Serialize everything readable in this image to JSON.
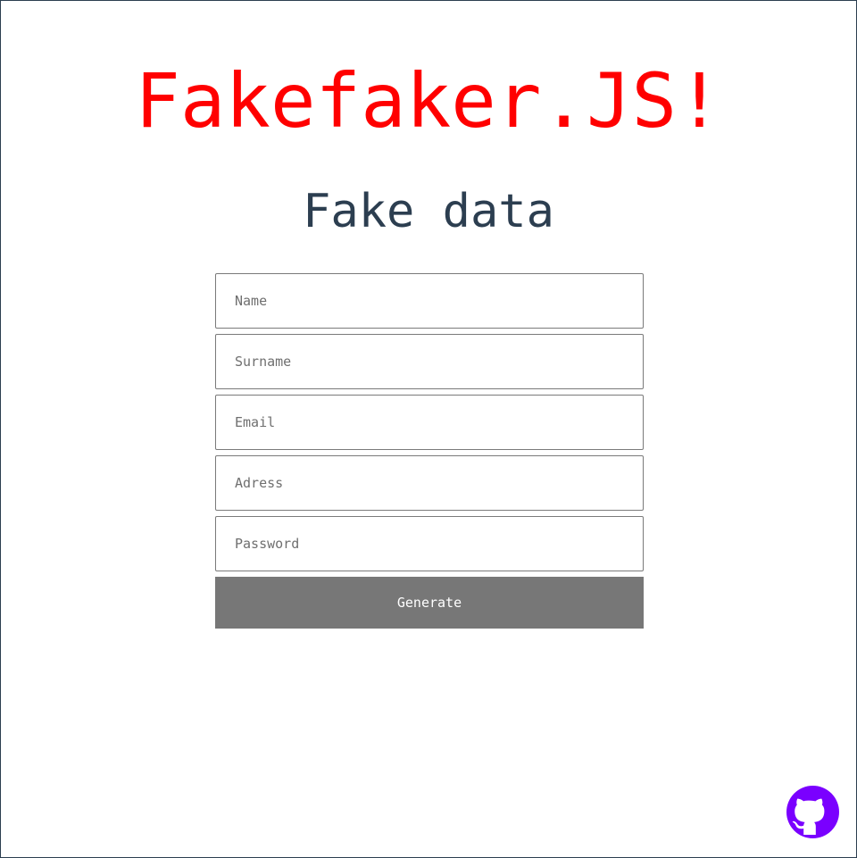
{
  "header": {
    "app_title": "Fakefaker.JS!",
    "section_title": "Fake data"
  },
  "form": {
    "fields": [
      {
        "placeholder": "Name",
        "value": ""
      },
      {
        "placeholder": "Surname",
        "value": ""
      },
      {
        "placeholder": "Email",
        "value": ""
      },
      {
        "placeholder": "Adress",
        "value": ""
      },
      {
        "placeholder": "Password",
        "value": ""
      }
    ],
    "generate_label": "Generate"
  },
  "footer": {
    "github_icon": "github-icon"
  },
  "colors": {
    "title": "#ff0000",
    "section_title": "#2c3e50",
    "button_bg": "#777777",
    "button_text": "#ffffff",
    "github": "#7a00ff",
    "frame_border": "#2c3e50"
  }
}
